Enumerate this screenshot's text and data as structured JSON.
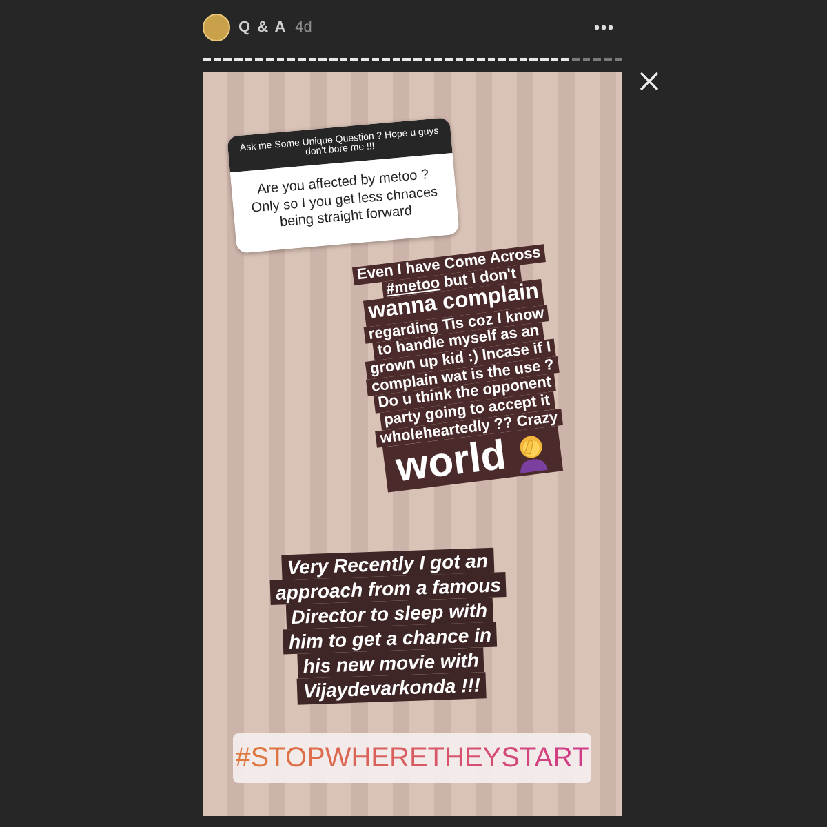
{
  "header": {
    "title": "Q & A",
    "time": "4d"
  },
  "question_sticker": {
    "prompt": "Ask me Some Unique Question ? Hope u guys don't bore me !!!",
    "question": "Are you affected by metoo ? Only so I you get less chnaces being straight forward"
  },
  "caption_1": [
    {
      "kind": "normal",
      "segments": [
        {
          "text": "Even I have Come Across",
          "underlined": false
        }
      ]
    },
    {
      "kind": "normal",
      "segments": [
        {
          "text": "#metoo",
          "underlined": true
        },
        {
          "text": " but I don't",
          "underlined": false
        }
      ]
    },
    {
      "kind": "large",
      "segments": [
        {
          "text": "wanna complain",
          "underlined": false
        }
      ]
    },
    {
      "kind": "normal",
      "segments": [
        {
          "text": "regarding Tis coz I know",
          "underlined": false
        }
      ]
    },
    {
      "kind": "normal",
      "segments": [
        {
          "text": "to handle myself as an",
          "underlined": false
        }
      ]
    },
    {
      "kind": "normal",
      "segments": [
        {
          "text": "grown up kid :) Incase if I",
          "underlined": false
        }
      ]
    },
    {
      "kind": "normal",
      "segments": [
        {
          "text": "complain wat is the use ?",
          "underlined": false
        }
      ]
    },
    {
      "kind": "normal",
      "segments": [
        {
          "text": "Do u think the opponent",
          "underlined": false
        }
      ]
    },
    {
      "kind": "normal",
      "segments": [
        {
          "text": "party going to accept it",
          "underlined": false
        }
      ]
    },
    {
      "kind": "normal",
      "segments": [
        {
          "text": "wholeheartedly ?? Crazy",
          "underlined": false
        }
      ]
    },
    {
      "kind": "closing",
      "segments": [
        {
          "text": "world",
          "underlined": false
        }
      ]
    }
  ],
  "caption_2": [
    "Very Recently I got an",
    "approach from a famous",
    "Director to sleep with",
    "him to get a chance in",
    "his new movie with",
    "Vijaydevarkonda !!!"
  ],
  "hashtag": "#STOPWHERETHEYSTART",
  "progress": {
    "level": 0.875
  }
}
